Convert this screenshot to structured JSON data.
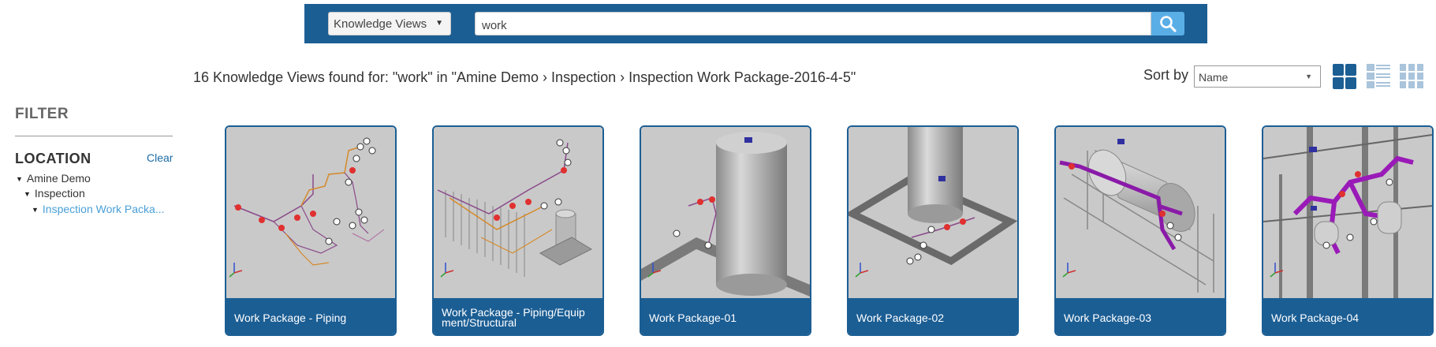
{
  "search": {
    "scope_label": "Knowledge Views",
    "query": "work"
  },
  "results": {
    "summary": "16 Knowledge Views found for: \"work\" in \"Amine Demo › Inspection › Inspection Work Package-2016-4-5\"",
    "sort_label": "Sort by",
    "sort_value": "Name"
  },
  "filter": {
    "title": "FILTER",
    "location_title": "LOCATION",
    "clear_label": "Clear",
    "tree": [
      "Amine Demo",
      "Inspection",
      "Inspection Work Packa..."
    ]
  },
  "cards": [
    {
      "title": "Work Package - Piping"
    },
    {
      "title": "Work Package - Piping/Equip ment/Structural"
    },
    {
      "title": "Work Package-01"
    },
    {
      "title": "Work Package-02"
    },
    {
      "title": "Work Package-03"
    },
    {
      "title": "Work Package-04"
    }
  ],
  "colors": {
    "brand": "#1b5e94",
    "search_button": "#5aaee6",
    "link": "#4a9fd8"
  },
  "icons": [
    "search-icon",
    "chevron-down-icon",
    "grid-large-icon",
    "list-icon",
    "grid-small-icon",
    "caret-down-icon"
  ]
}
